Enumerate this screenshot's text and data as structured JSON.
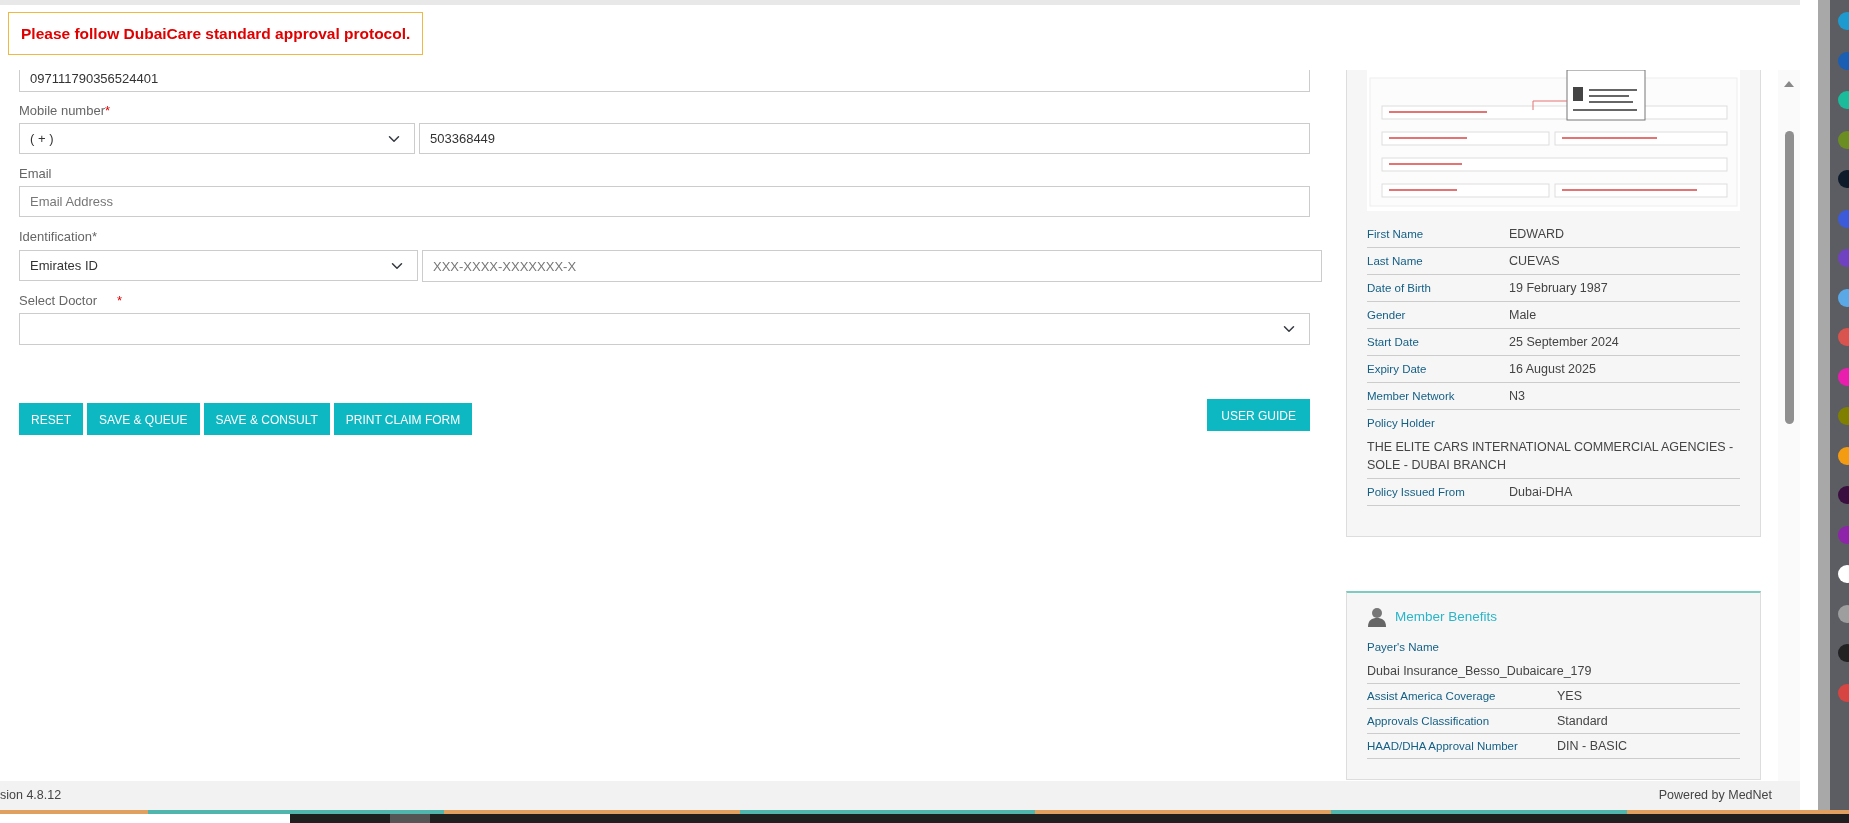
{
  "alert": "Please follow DubaiCare standard approval protocol.",
  "form": {
    "card_number": {
      "value": "097111790356524401"
    },
    "mobile": {
      "label": "Mobile number",
      "required_mark": "*",
      "country_code": "( + )",
      "value": "503368449"
    },
    "email": {
      "label": "Email",
      "placeholder": "Email Address"
    },
    "identification": {
      "label": "Identification*",
      "type": "Emirates ID",
      "placeholder": "XXX-XXXX-XXXXXXX-X"
    },
    "doctor": {
      "label": "Select Doctor",
      "required_mark": "*"
    }
  },
  "buttons": [
    "RESET",
    "SAVE & QUEUE",
    "SAVE & CONSULT",
    "PRINT CLAIM FORM"
  ],
  "user_guide": "USER GUIDE",
  "member_details": [
    {
      "label": "First Name",
      "value": "EDWARD",
      "kind": "inline"
    },
    {
      "label": "Last Name",
      "value": "CUEVAS",
      "kind": "inline"
    },
    {
      "label": "Date of Birth",
      "value": "19 February 1987",
      "kind": "inline"
    },
    {
      "label": "Gender",
      "value": "Male",
      "kind": "inline"
    },
    {
      "label": "Start Date",
      "value": "25 September 2024",
      "kind": "inline"
    },
    {
      "label": "Expiry Date",
      "value": "16 August 2025",
      "kind": "inline"
    },
    {
      "label": "Member Network",
      "value": "N3",
      "kind": "inline"
    },
    {
      "label": "Policy Holder",
      "value": "THE ELITE CARS INTERNATIONAL COMMERCIAL AGENCIES - SOLE - DUBAI BRANCH",
      "kind": "stacked"
    },
    {
      "label": "Policy Issued From",
      "value": "Dubai-DHA",
      "kind": "inline"
    }
  ],
  "member_benefits": {
    "title": "Member Benefits",
    "fields": [
      {
        "label": "Payer's Name",
        "value": "Dubai Insurance_Besso_Dubaicare_179",
        "kind": "stacked"
      },
      {
        "label": "Assist America Coverage",
        "value": "YES",
        "kind": "inline"
      },
      {
        "label": "Approvals Classification",
        "value": "Standard",
        "kind": "inline"
      },
      {
        "label": "HAAD/DHA Approval Number",
        "value": "DIN - BASIC",
        "kind": "inline"
      }
    ]
  },
  "footer": {
    "version": "sion 4.8.12",
    "powered_by": "Powered by MedNet"
  },
  "dock": [
    {
      "color": "#1d9bd1"
    },
    {
      "color": "#1a5fb4"
    },
    {
      "color": "#1abc9c"
    },
    {
      "color": "#6b8e23"
    },
    {
      "color": "#0d1b2a"
    },
    {
      "color": "#3b5bdb"
    },
    {
      "color": "#6f42c1"
    },
    {
      "color": "#5aa9e6"
    },
    {
      "color": "#d9534f"
    },
    {
      "color": "#e91eaf"
    },
    {
      "color": "#808000"
    },
    {
      "color": "#f39c12"
    },
    {
      "color": "#3a0f3f"
    },
    {
      "color": "#8e24aa"
    },
    {
      "color": "#ffffff"
    },
    {
      "color": "#9e9e9e"
    },
    {
      "color": "#222222"
    },
    {
      "color": "#d64541"
    }
  ]
}
